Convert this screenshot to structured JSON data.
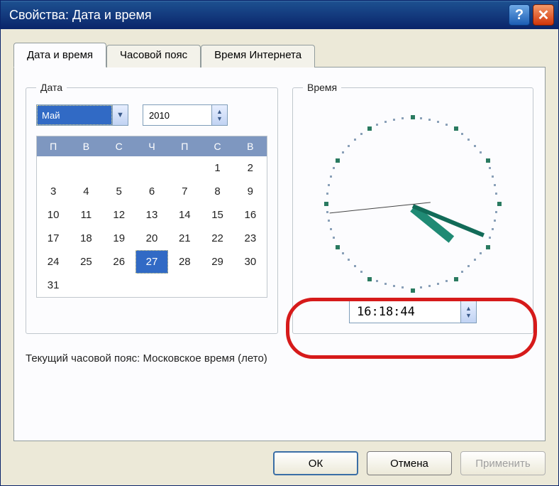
{
  "window": {
    "title": "Свойства: Дата и время"
  },
  "tabs": {
    "datetime": "Дата и время",
    "timezone": "Часовой пояс",
    "internet": "Время Интернета"
  },
  "groups": {
    "date": "Дата",
    "time": "Время"
  },
  "date": {
    "month": "Май",
    "year": "2010",
    "weekdays": [
      "П",
      "В",
      "С",
      "Ч",
      "П",
      "С",
      "В"
    ],
    "grid": [
      [
        "",
        "",
        "",
        "",
        "",
        "1",
        "2"
      ],
      [
        "3",
        "4",
        "5",
        "6",
        "7",
        "8",
        "9"
      ],
      [
        "10",
        "11",
        "12",
        "13",
        "14",
        "15",
        "16"
      ],
      [
        "17",
        "18",
        "19",
        "20",
        "21",
        "22",
        "23"
      ],
      [
        "24",
        "25",
        "26",
        "27",
        "28",
        "29",
        "30"
      ],
      [
        "31",
        "",
        "",
        "",
        "",
        "",
        ""
      ]
    ],
    "selected_day": "27"
  },
  "time": {
    "value": "16:18:44"
  },
  "timezone_label": "Текущий часовой пояс: Московское время (лето)",
  "buttons": {
    "ok": "ОК",
    "cancel": "Отмена",
    "apply": "Применить"
  }
}
